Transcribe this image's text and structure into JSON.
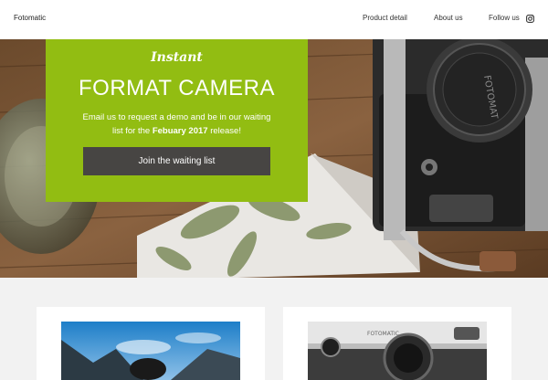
{
  "nav": {
    "brand": "Fotomatic",
    "links": [
      "Product detail",
      "About us",
      "Follow us"
    ],
    "social_icon": "instagram-icon"
  },
  "hero": {
    "script_title": "Instant",
    "title": "FORMAT CAMERA",
    "text_prefix": "Email us to request a demo and be in our waiting list for the",
    "text_bold": "Febuary 2017",
    "text_suffix": "release!",
    "button_label": "Join the waiting list",
    "camera_lens_text": "FOTOMAT",
    "colors": {
      "promo_bg": "#92bd12",
      "button_bg": "#474543"
    }
  },
  "cards": [
    {
      "image": "mountain-photo"
    },
    {
      "image": "camera-photo",
      "image_text": "FOTOMATIC"
    }
  ]
}
